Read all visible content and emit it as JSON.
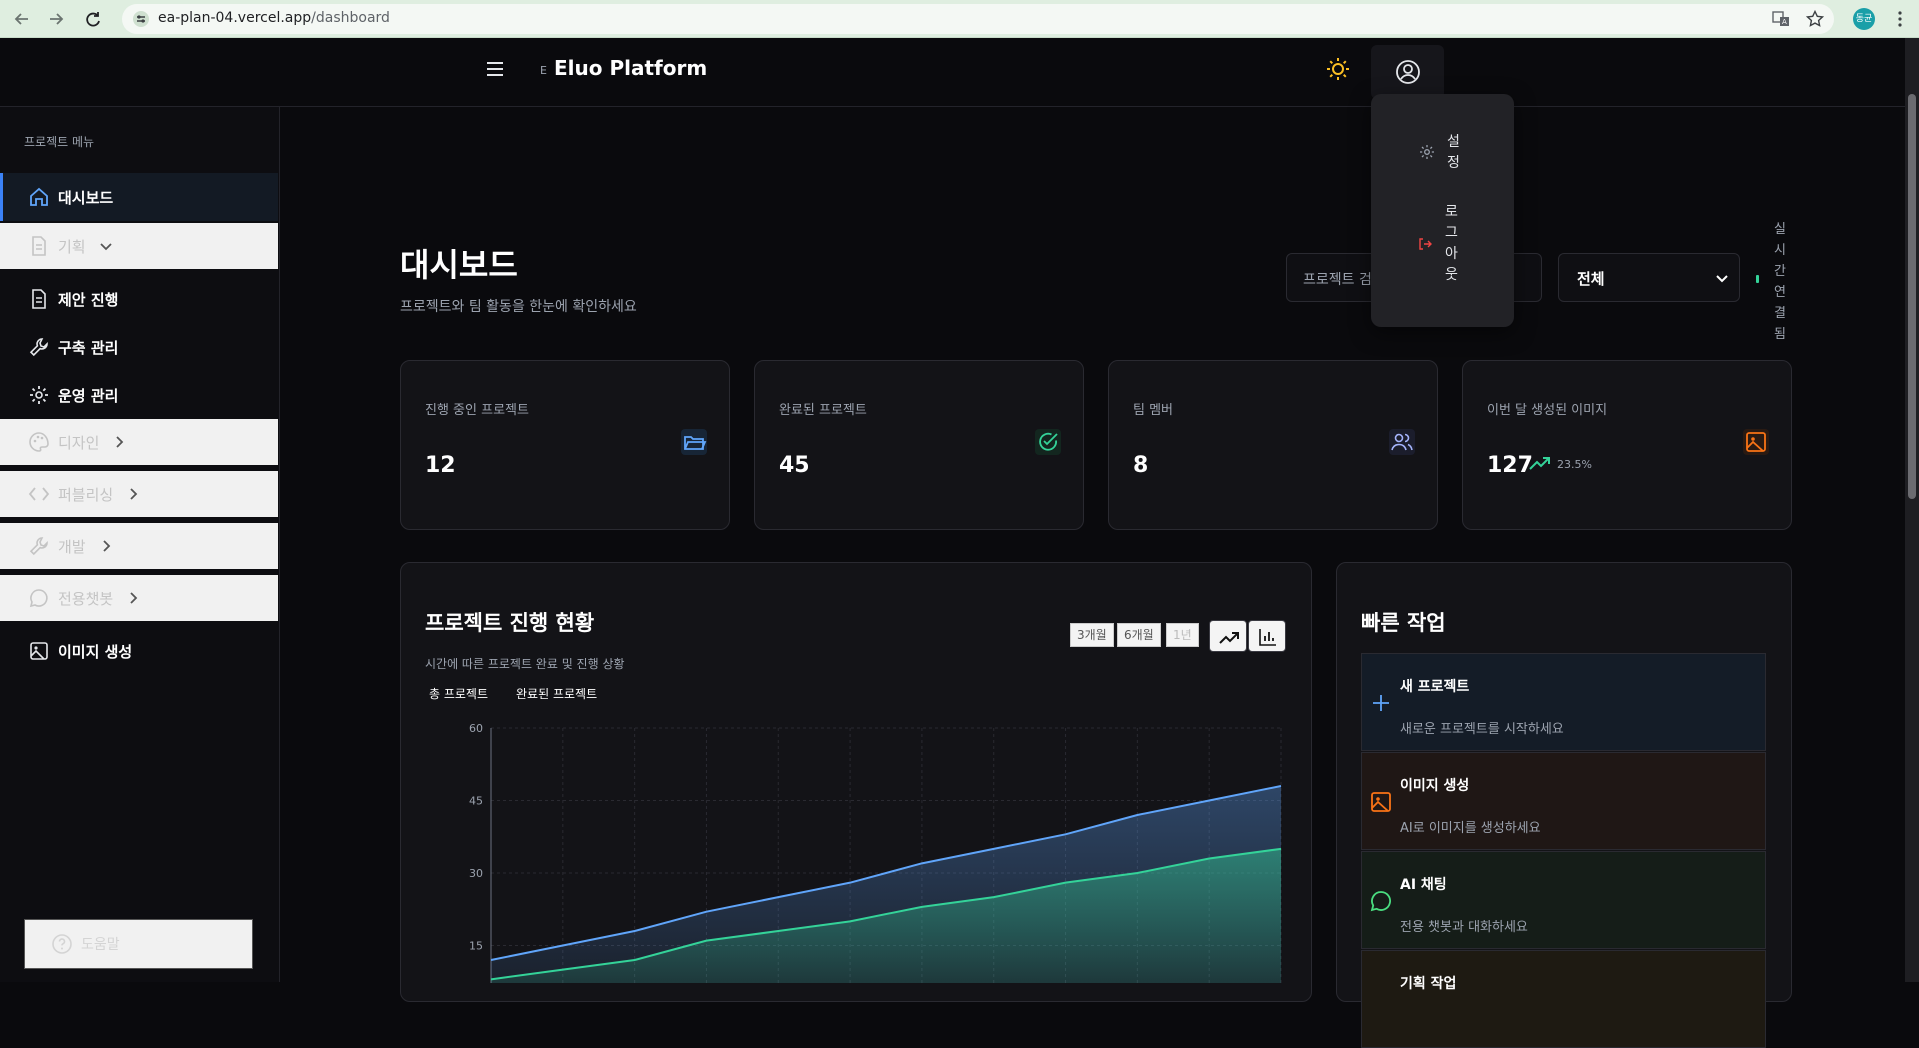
{
  "browser": {
    "url_host": "ea-plan-04.vercel.app",
    "url_path": "/dashboard",
    "profile_initial": "동균"
  },
  "header": {
    "brand_mark": "E",
    "brand_name": "Eluo Platform"
  },
  "user_menu": {
    "items": [
      {
        "label": "설정",
        "icon": "gear-icon"
      },
      {
        "label": "로그아웃",
        "icon": "logout-icon"
      }
    ]
  },
  "sidebar": {
    "title": "프로젝트 메뉴",
    "items": [
      {
        "label": "대시보드",
        "icon": "home-icon",
        "state": "active"
      },
      {
        "label": "기획",
        "icon": "document-icon",
        "state": "light",
        "chevron": "down"
      },
      {
        "label": "제안 진행",
        "icon": "document-icon",
        "state": "normal"
      },
      {
        "label": "구축 관리",
        "icon": "wrench-icon",
        "state": "normal"
      },
      {
        "label": "운영 관리",
        "icon": "gear-icon",
        "state": "normal"
      },
      {
        "label": "디자인",
        "icon": "palette-icon",
        "state": "light",
        "chevron": "right"
      },
      {
        "label": "퍼블리싱",
        "icon": "code-icon",
        "state": "light",
        "chevron": "right"
      },
      {
        "label": "개발",
        "icon": "wrench-icon",
        "state": "light",
        "chevron": "right"
      },
      {
        "label": "전용챗봇",
        "icon": "chat-icon",
        "state": "light",
        "chevron": "right"
      },
      {
        "label": "이미지 생성",
        "icon": "image-icon",
        "state": "normal"
      }
    ],
    "help_label": "도움말"
  },
  "main": {
    "title": "대시보드",
    "subtitle": "프로젝트와 팀 활동을 한눈에 확인하세요",
    "search_placeholder": "프로젝트 검색...",
    "filter_value": "전체",
    "live_status": "실시간연결됨"
  },
  "stats": [
    {
      "label": "진행 중인 프로젝트",
      "value": "12",
      "icon": "folder-icon",
      "color": "#60a5fa"
    },
    {
      "label": "완료된 프로젝트",
      "value": "45",
      "icon": "check-circle-icon",
      "color": "#34d399"
    },
    {
      "label": "팀 멤버",
      "value": "8",
      "icon": "users-icon",
      "color": "#a5b4fc"
    },
    {
      "label": "이번 달 생성된 이미지",
      "value": "127",
      "icon": "image-icon",
      "color": "#f97316",
      "trend": "23.5%"
    }
  ],
  "chart_panel": {
    "title": "프로젝트 진행 현황",
    "subtitle": "시간에 따른 프로젝트 완료 및 진행 상황",
    "ranges": [
      "3개월",
      "6개월",
      "1년"
    ]
  },
  "chart_data": {
    "type": "area",
    "ylim": [
      0,
      60
    ],
    "yticks": [
      15,
      30,
      45,
      60
    ],
    "x": [
      0,
      1,
      2,
      3,
      4,
      5,
      6,
      7,
      8,
      9,
      10,
      11
    ],
    "series": [
      {
        "name": "총 프로젝트",
        "color": "#60a5fa",
        "values": [
          12,
          15,
          18,
          22,
          25,
          28,
          32,
          35,
          38,
          42,
          45,
          48
        ]
      },
      {
        "name": "완료된 프로젝트",
        "color": "#34d399",
        "values": [
          8,
          10,
          12,
          16,
          18,
          20,
          23,
          25,
          28,
          30,
          33,
          35
        ]
      }
    ],
    "grid": true
  },
  "quick_actions": {
    "title": "빠른 작업",
    "items": [
      {
        "title": "새 프로젝트",
        "desc": "새로운 프로젝트를 시작하세요",
        "icon": "plus-icon",
        "color": "#60a5fa",
        "bg": "#141c27"
      },
      {
        "title": "이미지 생성",
        "desc": "AI로 이미지를 생성하세요",
        "icon": "image-icon",
        "color": "#f97316",
        "bg": "#1f1715"
      },
      {
        "title": "AI 채팅",
        "desc": "전용 챗봇과 대화하세요",
        "icon": "chat-icon",
        "color": "#4ade80",
        "bg": "#151d18"
      },
      {
        "title": "기획 작업",
        "desc": "",
        "icon": "document-icon",
        "color": "#facc15",
        "bg": "#1e1a12"
      }
    ]
  }
}
